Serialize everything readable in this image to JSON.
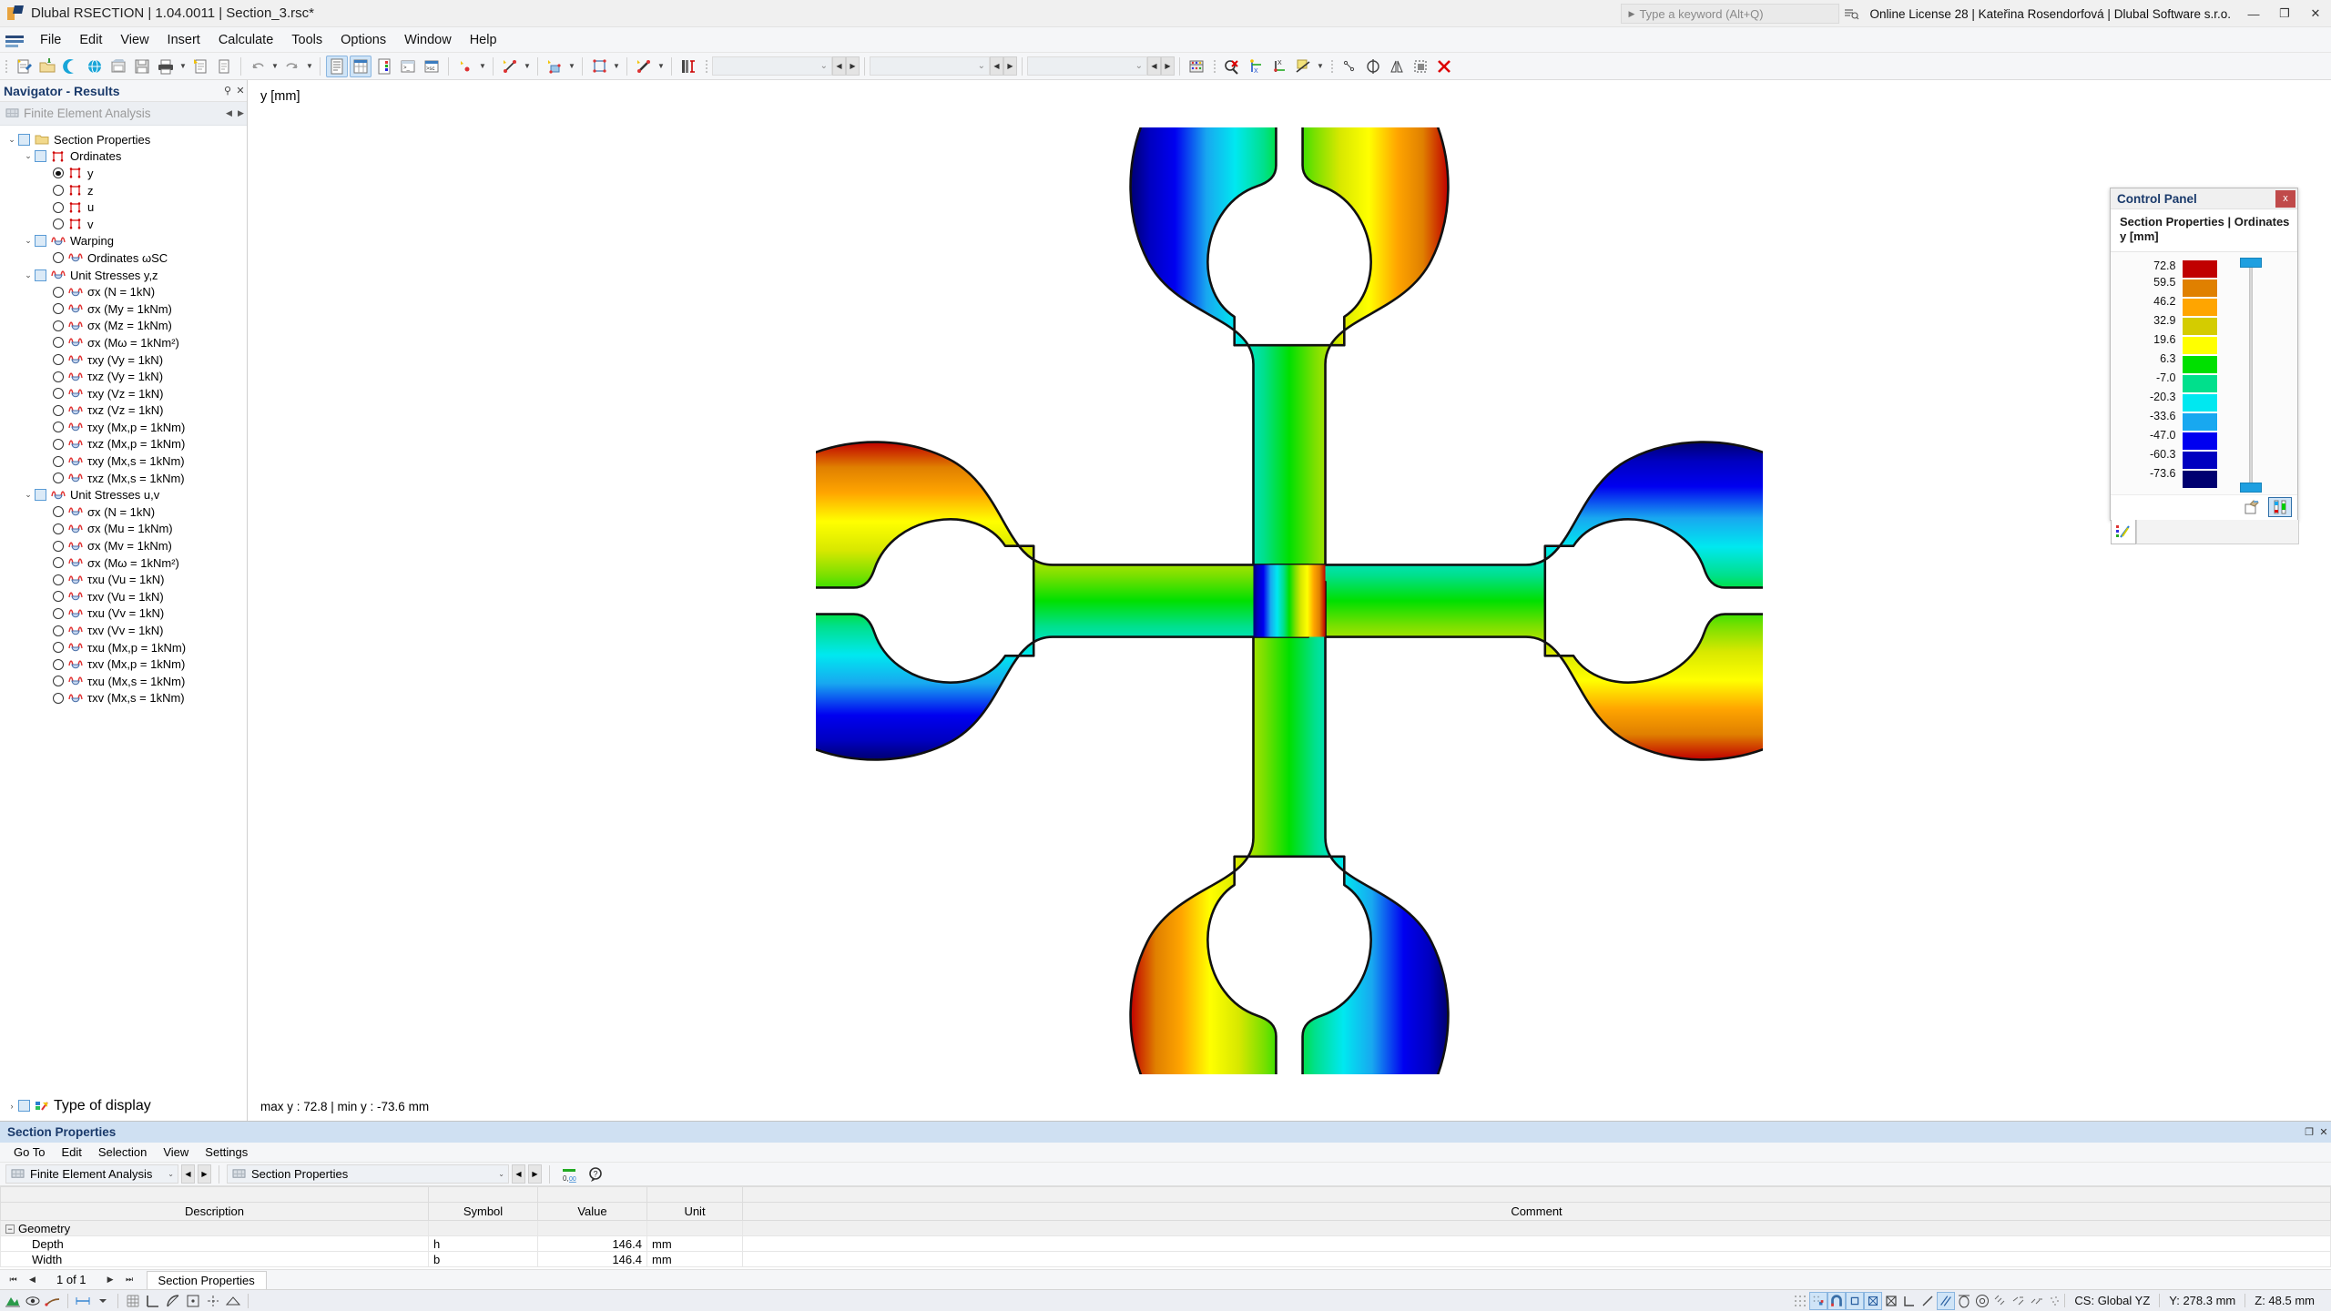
{
  "titlebar": {
    "title": "Dlubal RSECTION | 1.04.0011 | Section_3.rsc*",
    "search_placeholder": "Type a keyword (Alt+Q)",
    "license": "Online License 28 | Kateřina Rosendorfová | Dlubal Software s.r.o.",
    "minimize": "—",
    "restore": "❐",
    "close": "✕"
  },
  "menu": [
    "File",
    "Edit",
    "View",
    "Insert",
    "Calculate",
    "Tools",
    "Options",
    "Window",
    "Help"
  ],
  "navigator": {
    "title": "Navigator - Results",
    "pin": "⚲",
    "close": "✕",
    "selector": "Finite Element Analysis",
    "items": [
      {
        "label": "Section Properties",
        "indent": 0,
        "expander": "⌄",
        "control": "check",
        "icon": "folder-icon"
      },
      {
        "label": "Ordinates",
        "indent": 1,
        "expander": "⌄",
        "control": "check",
        "icon": "ordinate-icon"
      },
      {
        "label": "y",
        "indent": 2,
        "expander": "",
        "control": "radio-on",
        "icon": "ordinate-icon"
      },
      {
        "label": "z",
        "indent": 2,
        "expander": "",
        "control": "radio",
        "icon": "ordinate-icon"
      },
      {
        "label": "u",
        "indent": 2,
        "expander": "",
        "control": "radio",
        "icon": "ordinate-icon"
      },
      {
        "label": "v",
        "indent": 2,
        "expander": "",
        "control": "radio",
        "icon": "ordinate-icon"
      },
      {
        "label": "Warping",
        "indent": 1,
        "expander": "⌄",
        "control": "check",
        "icon": "warping-icon"
      },
      {
        "label": "Ordinates ωSC",
        "indent": 2,
        "expander": "",
        "control": "radio",
        "icon": "warping-icon"
      },
      {
        "label": "Unit Stresses y,z",
        "indent": 1,
        "expander": "⌄",
        "control": "check",
        "icon": "warping-icon"
      },
      {
        "label": "σx (N = 1kN)",
        "indent": 2,
        "expander": "",
        "control": "radio",
        "icon": "warping-icon"
      },
      {
        "label": "σx (My = 1kNm)",
        "indent": 2,
        "expander": "",
        "control": "radio",
        "icon": "warping-icon"
      },
      {
        "label": "σx (Mz = 1kNm)",
        "indent": 2,
        "expander": "",
        "control": "radio",
        "icon": "warping-icon"
      },
      {
        "label": "σx (Mω = 1kNm²)",
        "indent": 2,
        "expander": "",
        "control": "radio",
        "icon": "warping-icon"
      },
      {
        "label": "τxy (Vy = 1kN)",
        "indent": 2,
        "expander": "",
        "control": "radio",
        "icon": "warping-icon"
      },
      {
        "label": "τxz (Vy = 1kN)",
        "indent": 2,
        "expander": "",
        "control": "radio",
        "icon": "warping-icon"
      },
      {
        "label": "τxy (Vz = 1kN)",
        "indent": 2,
        "expander": "",
        "control": "radio",
        "icon": "warping-icon"
      },
      {
        "label": "τxz (Vz = 1kN)",
        "indent": 2,
        "expander": "",
        "control": "radio",
        "icon": "warping-icon"
      },
      {
        "label": "τxy (Mx,p = 1kNm)",
        "indent": 2,
        "expander": "",
        "control": "radio",
        "icon": "warping-icon"
      },
      {
        "label": "τxz (Mx,p = 1kNm)",
        "indent": 2,
        "expander": "",
        "control": "radio",
        "icon": "warping-icon"
      },
      {
        "label": "τxy (Mx,s = 1kNm)",
        "indent": 2,
        "expander": "",
        "control": "radio",
        "icon": "warping-icon"
      },
      {
        "label": "τxz (Mx,s = 1kNm)",
        "indent": 2,
        "expander": "",
        "control": "radio",
        "icon": "warping-icon"
      },
      {
        "label": "Unit Stresses u,v",
        "indent": 1,
        "expander": "⌄",
        "control": "check",
        "icon": "warping-icon"
      },
      {
        "label": "σx (N = 1kN)",
        "indent": 2,
        "expander": "",
        "control": "radio",
        "icon": "warping-icon"
      },
      {
        "label": "σx (Mu = 1kNm)",
        "indent": 2,
        "expander": "",
        "control": "radio",
        "icon": "warping-icon"
      },
      {
        "label": "σx (Mv = 1kNm)",
        "indent": 2,
        "expander": "",
        "control": "radio",
        "icon": "warping-icon"
      },
      {
        "label": "σx (Mω = 1kNm²)",
        "indent": 2,
        "expander": "",
        "control": "radio",
        "icon": "warping-icon"
      },
      {
        "label": "τxu (Vu = 1kN)",
        "indent": 2,
        "expander": "",
        "control": "radio",
        "icon": "warping-icon"
      },
      {
        "label": "τxv (Vu = 1kN)",
        "indent": 2,
        "expander": "",
        "control": "radio",
        "icon": "warping-icon"
      },
      {
        "label": "τxu (Vv = 1kN)",
        "indent": 2,
        "expander": "",
        "control": "radio",
        "icon": "warping-icon"
      },
      {
        "label": "τxv (Vv = 1kN)",
        "indent": 2,
        "expander": "",
        "control": "radio",
        "icon": "warping-icon"
      },
      {
        "label": "τxu (Mx,p = 1kNm)",
        "indent": 2,
        "expander": "",
        "control": "radio",
        "icon": "warping-icon"
      },
      {
        "label": "τxv (Mx,p = 1kNm)",
        "indent": 2,
        "expander": "",
        "control": "radio",
        "icon": "warping-icon"
      },
      {
        "label": "τxu (Mx,s = 1kNm)",
        "indent": 2,
        "expander": "",
        "control": "radio",
        "icon": "warping-icon"
      },
      {
        "label": "τxv (Mx,s = 1kNm)",
        "indent": 2,
        "expander": "",
        "control": "radio",
        "icon": "warping-icon"
      }
    ],
    "type_of_display": {
      "label": "Type of display",
      "expander": "›"
    }
  },
  "viewport": {
    "axis_label": "y [mm]",
    "minmax": "max y : 72.8 | min y : -73.6 mm"
  },
  "control_panel": {
    "title": "Control Panel",
    "close": "x",
    "subtitle_line1": "Section Properties | Ordinates",
    "subtitle_line2": "y [mm]",
    "legend_values": [
      "72.8",
      "59.5",
      "46.2",
      "32.9",
      "19.6",
      "6.3",
      "-7.0",
      "-20.3",
      "-33.6",
      "-47.0",
      "-60.3",
      "-73.6"
    ],
    "legend_colors": [
      "#c00000",
      "#e08000",
      "#ffa500",
      "#d4cc00",
      "#ffff00",
      "#00e000",
      "#00e08c",
      "#00e8f0",
      "#18a8f0",
      "#0000f0",
      "#0000c0",
      "#000070"
    ]
  },
  "chart_data": {
    "type": "heatmap",
    "title": "Section Properties | Ordinates y [mm]",
    "quantity": "y",
    "unit": "mm",
    "max": 72.8,
    "min": -73.6,
    "legend_stops": [
      72.8,
      59.5,
      46.2,
      32.9,
      19.6,
      6.3,
      -7.0,
      -20.3,
      -33.6,
      -47.0,
      -60.3,
      -73.6
    ],
    "legend_colors": [
      "#c00000",
      "#e08000",
      "#ffa500",
      "#d4cc00",
      "#ffff00",
      "#00e000",
      "#00e08c",
      "#00e8f0",
      "#18a8f0",
      "#0000f0",
      "#0000c0",
      "#000070"
    ],
    "gradient_axis": "horizontal",
    "geometry": "cruciform section with four C-shaped arms",
    "depth_mm": 146.4,
    "width_mm": 146.4
  },
  "bottom_panel": {
    "title": "Section Properties",
    "restore": "❐",
    "close": "✕",
    "menu": [
      "Go To",
      "Edit",
      "Selection",
      "View",
      "Settings"
    ],
    "combo_left": "Finite Element Analysis",
    "combo_right": "Section Properties",
    "columns": [
      "Description",
      "Symbol",
      "Value",
      "Unit",
      "Comment"
    ],
    "rows": [
      {
        "type": "group",
        "description": "Geometry",
        "symbol": "",
        "value": "",
        "unit": "",
        "comment": ""
      },
      {
        "type": "row",
        "description": "Depth",
        "symbol": "h",
        "value": "146.4",
        "unit": "mm",
        "comment": ""
      },
      {
        "type": "row",
        "description": "Width",
        "symbol": "b",
        "value": "146.4",
        "unit": "mm",
        "comment": ""
      }
    ],
    "page_indicator": "1 of 1",
    "first": "⏮",
    "prev": "◀",
    "next": "▶",
    "last": "⏭",
    "tab": "Section Properties"
  },
  "statusbar": {
    "cs": "CS: Global YZ",
    "y": "Y: 278.3 mm",
    "z": "Z: 48.5 mm"
  }
}
